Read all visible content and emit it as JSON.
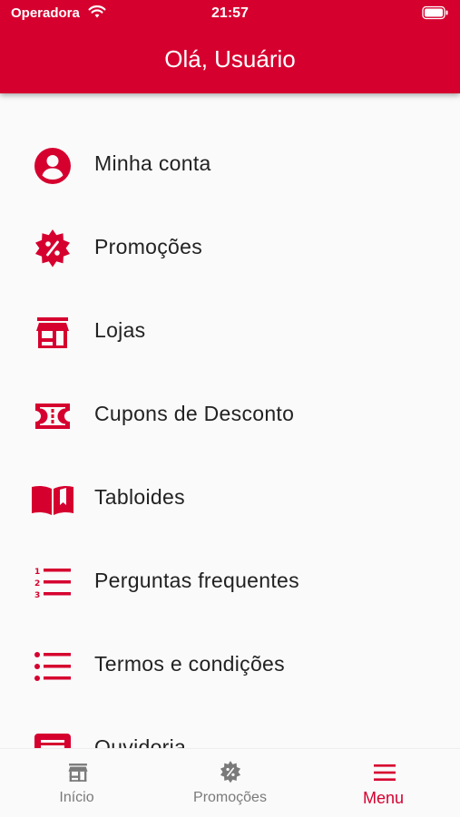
{
  "status_bar": {
    "carrier": "Operadora",
    "time": "21:57"
  },
  "header": {
    "title": "Olá, Usuário"
  },
  "menu": {
    "items": [
      {
        "label": "Minha conta",
        "icon": "account-circle-icon"
      },
      {
        "label": "Promoções",
        "icon": "discount-badge-icon"
      },
      {
        "label": "Lojas",
        "icon": "store-icon"
      },
      {
        "label": "Cupons de Desconto",
        "icon": "coupon-ticket-icon"
      },
      {
        "label": "Tabloides",
        "icon": "open-book-icon"
      },
      {
        "label": "Perguntas frequentes",
        "icon": "numbered-list-icon"
      },
      {
        "label": "Termos e condições",
        "icon": "bulleted-list-icon"
      },
      {
        "label": "Ouvidoria",
        "icon": "feedback-form-icon"
      }
    ]
  },
  "tabbar": {
    "tabs": [
      {
        "label": "Início",
        "icon": "store-icon",
        "active": false
      },
      {
        "label": "Promoções",
        "icon": "discount-badge-icon",
        "active": false
      },
      {
        "label": "Menu",
        "icon": "hamburger-menu-icon",
        "active": true
      }
    ]
  },
  "colors": {
    "brand": "#d6002f",
    "background": "#fafafa",
    "text": "#222222",
    "inactive_tab": "#7a7a7a"
  }
}
